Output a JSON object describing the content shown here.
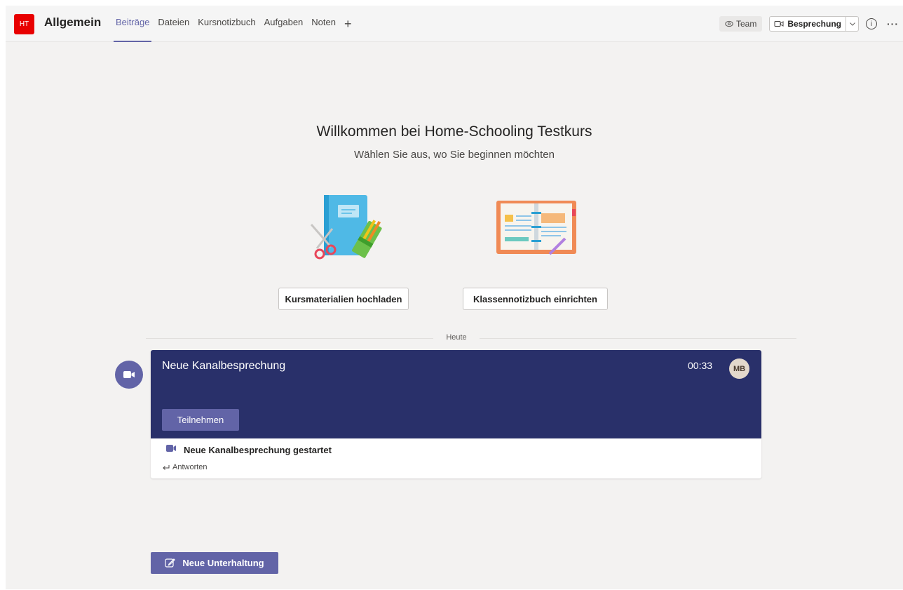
{
  "header": {
    "team_initials": "HT",
    "channel_name": "Allgemein",
    "tabs": [
      {
        "label": "Beiträge",
        "active": true
      },
      {
        "label": "Dateien",
        "active": false
      },
      {
        "label": "Kursnotizbuch",
        "active": false
      },
      {
        "label": "Aufgaben",
        "active": false
      },
      {
        "label": "Noten",
        "active": false
      }
    ],
    "add_tab_icon": "plus-icon",
    "team_label": "Team",
    "meeting_label": "Besprechung",
    "info_icon": "info-icon",
    "more_icon": "more-icon"
  },
  "welcome": {
    "title": "Willkommen bei Home-Schooling Testkurs",
    "subtitle": "Wählen Sie aus, wo Sie beginnen möchten",
    "upload_button": "Kursmaterialien hochladen",
    "notebook_button": "Klassennotizbuch einrichten"
  },
  "feed": {
    "date_divider": "Heute",
    "meeting_card": {
      "title": "Neue Kanalbesprechung",
      "duration": "00:33",
      "avatar_initials": "MB",
      "join_label": "Teilnehmen",
      "event_text": "Neue Kanalbesprechung gestartet",
      "reply_label": "Antworten"
    }
  },
  "compose": {
    "new_conversation_label": "Neue Unterhaltung"
  },
  "colors": {
    "brand": "#6264a7",
    "meeting_banner": "#29306a",
    "team_avatar": "#e80000"
  }
}
